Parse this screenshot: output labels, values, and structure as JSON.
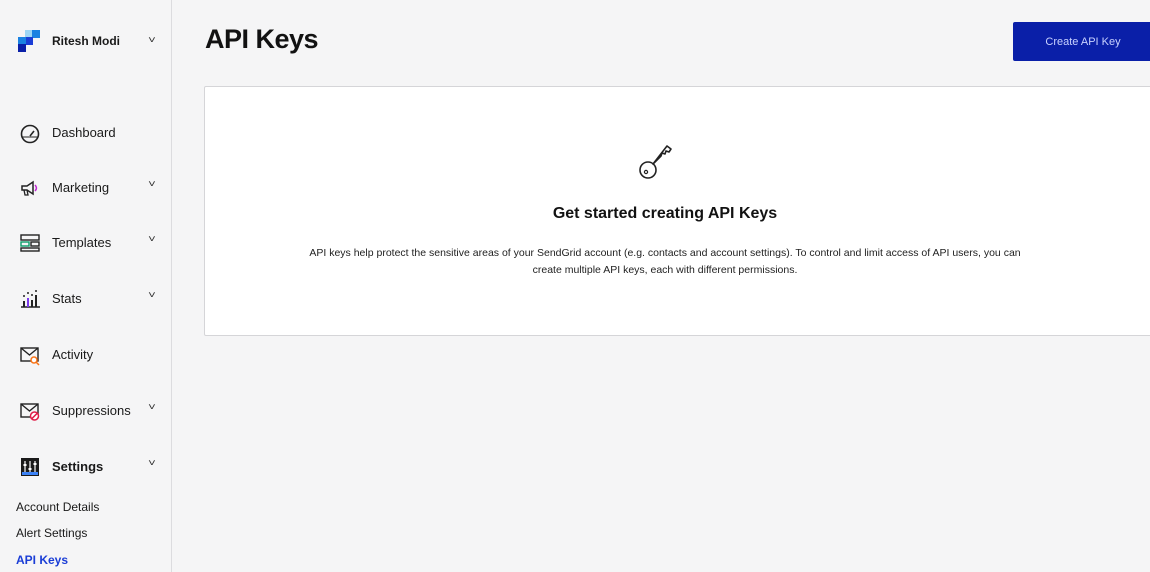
{
  "account": {
    "name": "Ritesh Modi"
  },
  "sidebar": {
    "items": [
      {
        "label": "Dashboard",
        "icon": "dashboard-gauge-icon"
      },
      {
        "label": "Marketing",
        "icon": "megaphone-icon"
      },
      {
        "label": "Templates",
        "icon": "templates-icon"
      },
      {
        "label": "Stats",
        "icon": "stats-chart-icon"
      },
      {
        "label": "Activity",
        "icon": "activity-search-icon"
      },
      {
        "label": "Suppressions",
        "icon": "suppressions-icon"
      },
      {
        "label": "Settings",
        "icon": "settings-sliders-icon"
      }
    ],
    "settings_subitems": [
      {
        "label": "Account Details"
      },
      {
        "label": "Alert Settings"
      },
      {
        "label": "API Keys"
      }
    ]
  },
  "header": {
    "title": "API Keys",
    "create_button": "Create API Key"
  },
  "empty_state": {
    "title": "Get started creating API Keys",
    "description": "API keys help protect the sensitive areas of your SendGrid account (e.g. contacts and account settings). To control and limit access of API users, you can create multiple API keys, each with different permissions."
  },
  "colors": {
    "accent": "#0a1fa8",
    "active_link": "#1a3dd6",
    "background": "#f5f5f6"
  }
}
